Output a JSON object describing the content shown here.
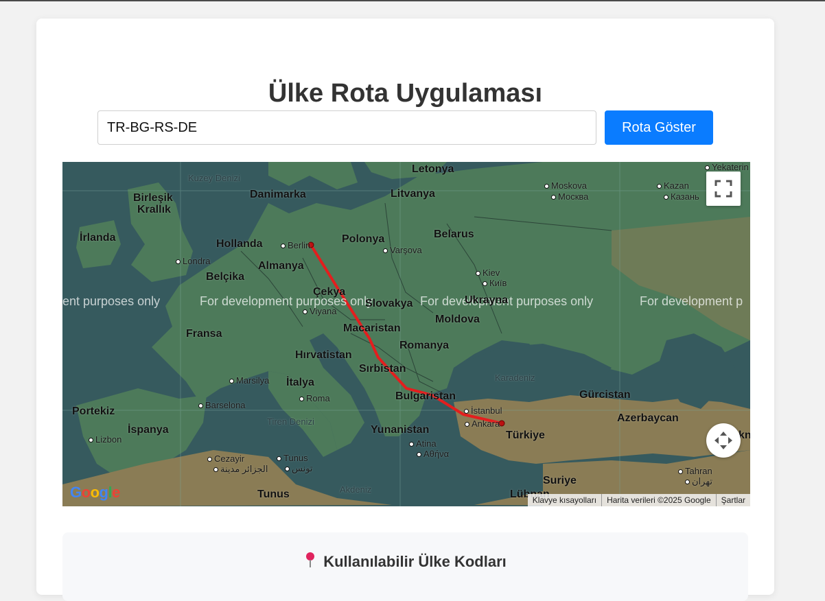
{
  "app": {
    "title": "Ülke Rota Uygulaması",
    "route_input_value": "TR-BG-RS-DE",
    "route_input_placeholder": "",
    "show_route_button": "Rota Göster"
  },
  "map": {
    "watermark": "For development purposes only",
    "watermark_left": "ent purposes only",
    "watermark_right": "For development p",
    "route_color": "#e31e1e",
    "countries": [
      {
        "id": "letonya",
        "text": "Letonya"
      },
      {
        "id": "danimarka",
        "text": "Danimarka"
      },
      {
        "id": "litvanya",
        "text": "Litvanya"
      },
      {
        "id": "birlesik-krallik-1",
        "text": "Birleşik"
      },
      {
        "id": "birlesik-krallik-2",
        "text": "Krallık"
      },
      {
        "id": "belarus",
        "text": "Belarus"
      },
      {
        "id": "irlanda",
        "text": "İrlanda"
      },
      {
        "id": "hollanda",
        "text": "Hollanda"
      },
      {
        "id": "polonya",
        "text": "Polonya"
      },
      {
        "id": "almanya",
        "text": "Almanya"
      },
      {
        "id": "belcika",
        "text": "Belçika"
      },
      {
        "id": "cekya",
        "text": "Çekya"
      },
      {
        "id": "slovakya",
        "text": "Slovakya"
      },
      {
        "id": "ukrayna",
        "text": "Ukrayna"
      },
      {
        "id": "moldova",
        "text": "Moldova"
      },
      {
        "id": "fransa",
        "text": "Fransa"
      },
      {
        "id": "macaristan",
        "text": "Macaristan"
      },
      {
        "id": "romanya",
        "text": "Romanya"
      },
      {
        "id": "hirvatistan",
        "text": "Hırvatistan"
      },
      {
        "id": "sirbistan",
        "text": "Sırbistan"
      },
      {
        "id": "italya",
        "text": "İtalya"
      },
      {
        "id": "bulgaristan",
        "text": "Bulgaristan"
      },
      {
        "id": "gurcistan",
        "text": "Gürcistan"
      },
      {
        "id": "portekiz",
        "text": "Portekiz"
      },
      {
        "id": "ispanya",
        "text": "İspanya"
      },
      {
        "id": "yunanistan",
        "text": "Yunanistan"
      },
      {
        "id": "turkiye",
        "text": "Türkiye"
      },
      {
        "id": "azerbaycan",
        "text": "Azerbaycan"
      },
      {
        "id": "suriye",
        "text": "Suriye"
      },
      {
        "id": "tunus",
        "text": "Tunus"
      },
      {
        "id": "lubnan",
        "text": "Lübnan"
      }
    ],
    "cities": [
      {
        "id": "moskova",
        "text": "Moskova"
      },
      {
        "id": "moskova-ru",
        "text": "Москва"
      },
      {
        "id": "kazan",
        "text": "Kazan"
      },
      {
        "id": "kazan-ru",
        "text": "Казань"
      },
      {
        "id": "berlin",
        "text": "Berlin"
      },
      {
        "id": "varsova",
        "text": "Varşova"
      },
      {
        "id": "londra",
        "text": "Londra"
      },
      {
        "id": "kiev",
        "text": "Kiev"
      },
      {
        "id": "kiev-uk",
        "text": "Київ"
      },
      {
        "id": "viyana",
        "text": "Viyana"
      },
      {
        "id": "marsilya",
        "text": "Marsilya"
      },
      {
        "id": "barselona",
        "text": "Barselona"
      },
      {
        "id": "roma",
        "text": "Roma"
      },
      {
        "id": "istanbul",
        "text": "İstanbul"
      },
      {
        "id": "ankara",
        "text": "Ankara"
      },
      {
        "id": "lizbon",
        "text": "Lizbon"
      },
      {
        "id": "atina",
        "text": "Atina"
      },
      {
        "id": "atina-gr",
        "text": "Αθήνα"
      },
      {
        "id": "cezayir",
        "text": "Cezayir"
      },
      {
        "id": "cezayir-ar",
        "text": "الجزائر مدينة"
      },
      {
        "id": "tunus-city",
        "text": "Tunus"
      },
      {
        "id": "tunus-ar",
        "text": "تونس"
      },
      {
        "id": "tahran",
        "text": "Tahran"
      },
      {
        "id": "tahran-fa",
        "text": "تهران"
      },
      {
        "id": "yekaterinburg",
        "text": "Yekaterin"
      }
    ],
    "seas": [
      {
        "id": "kuzey-denizi",
        "text": "Kuzey Denizi"
      },
      {
        "id": "karadeniz",
        "text": "Karadeniz"
      },
      {
        "id": "tiren-denizi",
        "text": "Tiren Denizi"
      },
      {
        "id": "akdeniz",
        "text": "Akdeniz"
      }
    ],
    "edge_label": "kn",
    "google_logo": "Google",
    "attribution": {
      "shortcuts": "Klavye kısayolları",
      "data": "Harita verileri ©2025 Google",
      "terms": "Şartlar"
    }
  },
  "codes_section": {
    "title": "Kullanılabilir Ülke Kodları",
    "icon": "pin-icon"
  },
  "colors": {
    "button": "#0a7cff",
    "water": "#365a5e",
    "land": "#4d7a5a",
    "route": "#e31e1e"
  }
}
